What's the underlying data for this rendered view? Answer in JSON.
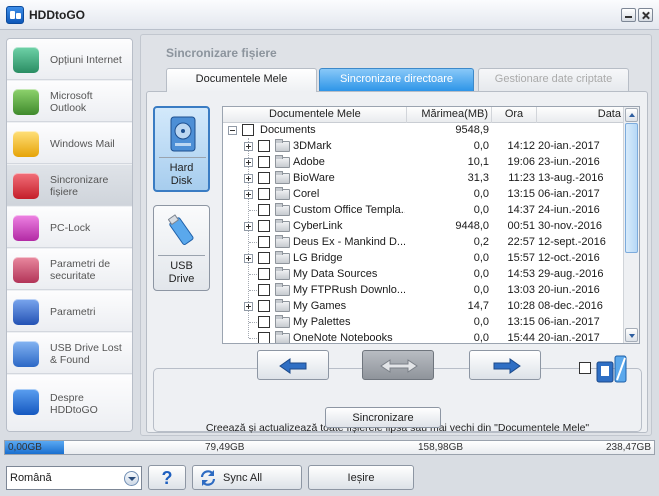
{
  "window": {
    "title": "HDDtoGO"
  },
  "sidebar": {
    "items": [
      {
        "label": "Opțiuni Internet",
        "icon": "globe-icon",
        "color": "#3aa37a"
      },
      {
        "label": "Microsoft Outlook",
        "icon": "outlook-icon",
        "color": "#4f9a3a"
      },
      {
        "label": "Windows Mail",
        "icon": "mail-icon",
        "color": "#f1b51a"
      },
      {
        "label": "Sincronizare fișiere",
        "icon": "folder-sync-icon",
        "color": "#d62c36",
        "active": true
      },
      {
        "label": "PC-Lock",
        "icon": "key-icon",
        "color": "#c43bb5"
      },
      {
        "label": "Parametri de securitate",
        "icon": "padlock-icon",
        "color": "#c2456a"
      },
      {
        "label": "Parametri",
        "icon": "gears-icon",
        "color": "#2f64c9"
      },
      {
        "label": "USB Drive Lost & Found",
        "icon": "usb-found-icon",
        "color": "#3879d8"
      },
      {
        "label": "Despre HDDtoGO",
        "icon": "hddtogo-logo-icon",
        "color": "#1f68d2"
      }
    ]
  },
  "main": {
    "section_title": "Sincronizare fișiere",
    "tabs": [
      {
        "label": "Documentele Mele",
        "state": "selected"
      },
      {
        "label": "Sincronizare directoare",
        "state": "highlighted"
      },
      {
        "label": "Gestionare date criptate",
        "state": "disabled"
      }
    ],
    "devices": [
      {
        "label_line1": "Hard",
        "label_line2": "Disk",
        "icon": "hard-disk-icon",
        "active": true
      },
      {
        "label_line1": "USB",
        "label_line2": "Drive",
        "icon": "usb-drive-icon",
        "active": false
      }
    ],
    "tree": {
      "columns": [
        "Documentele Mele",
        "Mărimea(MB)",
        "Ora",
        "Data"
      ],
      "root": {
        "name": "Documents",
        "size": "9548,9",
        "time": "",
        "date": ""
      },
      "rows": [
        {
          "name": "3DMark",
          "size": "0,0",
          "time": "14:12",
          "date": "20-ian.-2017",
          "expandable": true
        },
        {
          "name": "Adobe",
          "size": "10,1",
          "time": "19:06",
          "date": "23-iun.-2016",
          "expandable": true
        },
        {
          "name": "BioWare",
          "size": "31,3",
          "time": "11:23",
          "date": "13-aug.-2016",
          "expandable": true
        },
        {
          "name": "Corel",
          "size": "0,0",
          "time": "13:15",
          "date": "06-ian.-2017",
          "expandable": true
        },
        {
          "name": "Custom Office Templa...",
          "size": "0,0",
          "time": "14:37",
          "date": "24-iun.-2016",
          "expandable": false
        },
        {
          "name": "CyberLink",
          "size": "9448,0",
          "time": "00:51",
          "date": "30-nov.-2016",
          "expandable": true
        },
        {
          "name": "Deus Ex -  Mankind D...",
          "size": "0,2",
          "time": "22:57",
          "date": "12-sept.-2016",
          "expandable": false
        },
        {
          "name": "LG Bridge",
          "size": "0,0",
          "time": "15:57",
          "date": "12-oct.-2016",
          "expandable": true
        },
        {
          "name": "My Data Sources",
          "size": "0,0",
          "time": "14:53",
          "date": "29-aug.-2016",
          "expandable": false
        },
        {
          "name": "My FTPRush Downlo...",
          "size": "0,0",
          "time": "13:03",
          "date": "20-iun.-2016",
          "expandable": false
        },
        {
          "name": "My Games",
          "size": "14,7",
          "time": "10:28",
          "date": "08-dec.-2016",
          "expandable": true
        },
        {
          "name": "My Palettes",
          "size": "0,0",
          "time": "13:15",
          "date": "06-ian.-2017",
          "expandable": false
        },
        {
          "name": "OneNote Notebooks",
          "size": "0,0",
          "time": "15:44",
          "date": "20-ian.-2017",
          "expandable": false
        }
      ]
    },
    "sync_description": "Creează și actualizează toate fișierele lipsă sau mai vechi din \"Documentele Mele\"",
    "sync_button": "Sincronizare"
  },
  "progress": {
    "labels": [
      "0,00GB",
      "79,49GB",
      "158,98GB",
      "238,47GB"
    ],
    "used_fraction": 0.09
  },
  "footer": {
    "language": "Română",
    "help_label": "?",
    "sync_all_label": "Sync All",
    "exit_label": "Ieșire"
  },
  "colors": {
    "accent": "#2e95e8",
    "progress": "#1a6fcf"
  }
}
